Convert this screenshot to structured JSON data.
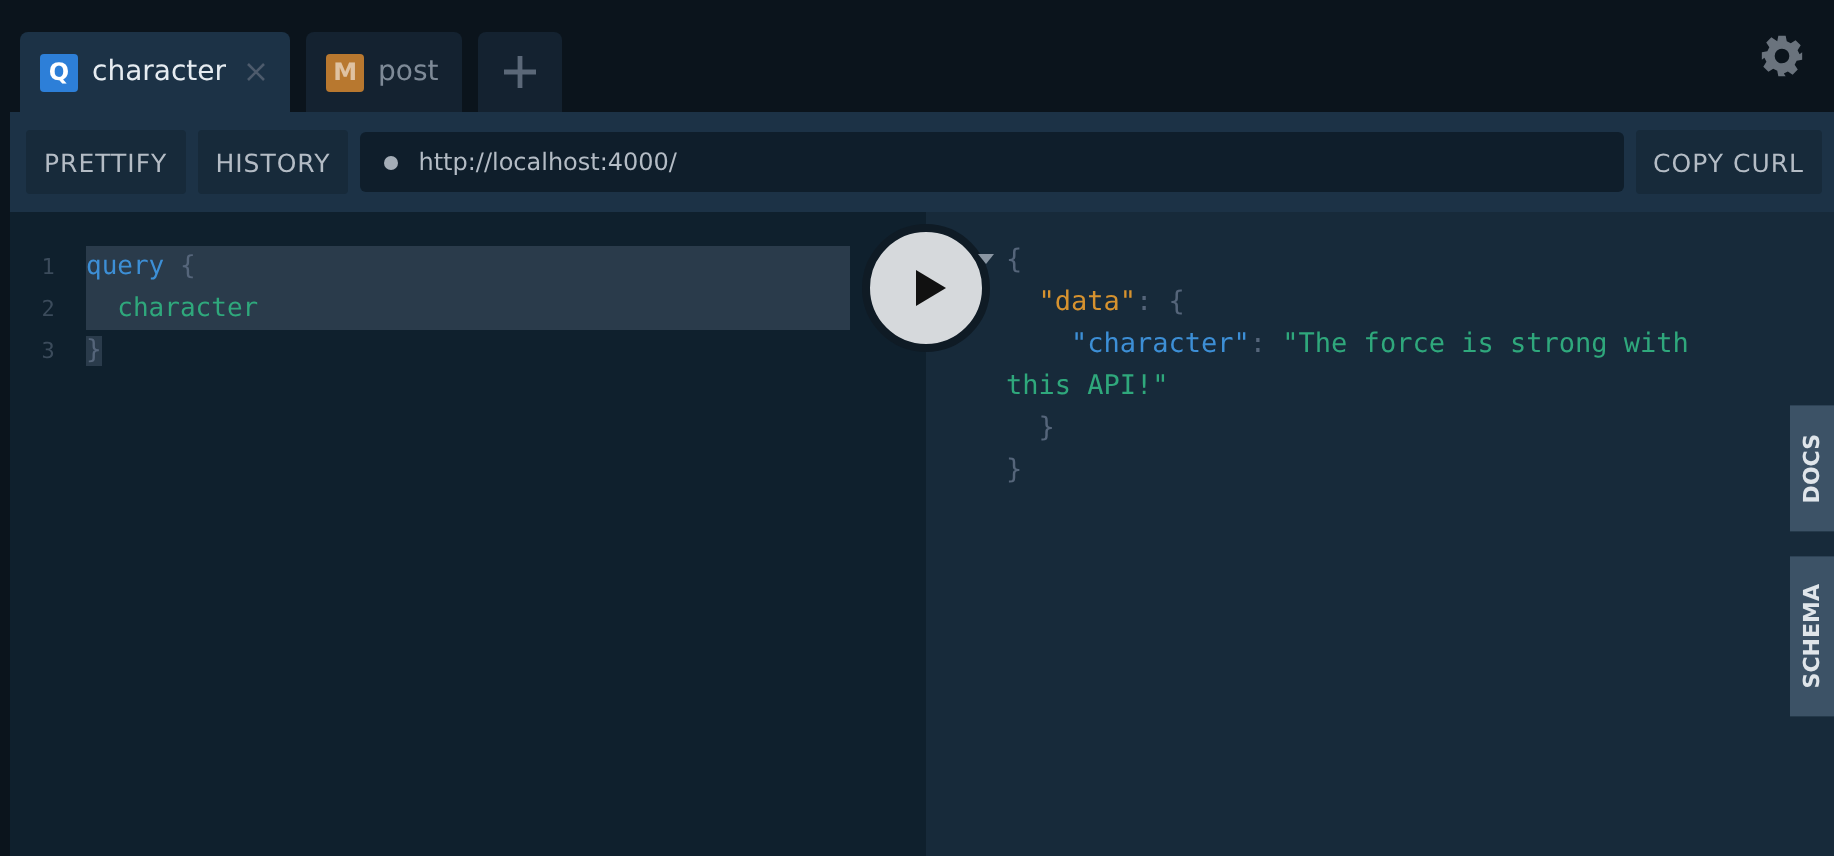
{
  "tabs": [
    {
      "badge": "Q",
      "color": "#2d7fd8",
      "label": "character",
      "selected": true,
      "closable": true
    },
    {
      "badge": "M",
      "color": "#b8782f",
      "label": "post",
      "selected": false,
      "closable": false
    }
  ],
  "toolbar": {
    "buttons": [
      "PRETTIFY",
      "HISTORY"
    ],
    "endpoint": "http://localhost:4000/",
    "copy_button": "COPY CURL"
  },
  "editor": {
    "lines": [
      {
        "number": "1",
        "selected": true,
        "tokens": [
          {
            "kind": "keyword",
            "text": "query"
          },
          {
            "kind": "punct",
            "text": " {"
          }
        ]
      },
      {
        "number": "2",
        "selected": true,
        "tokens": [
          {
            "kind": "field",
            "text": "  character"
          }
        ]
      },
      {
        "number": "3",
        "selected": false,
        "tokens": [
          {
            "kind": "punct",
            "text": "}",
            "selected": true
          }
        ]
      }
    ]
  },
  "result": {
    "tree": {
      "collapsible": true,
      "tokens": [
        {
          "kind": "punct",
          "text": "{"
        }
      ],
      "close": "}",
      "children": [
        {
          "collapsible": false,
          "tokens": [
            {
              "kind": "key",
              "text": "\"data\""
            },
            {
              "kind": "punct",
              "text": ": {"
            }
          ],
          "close": "}",
          "children": [
            {
              "collapsible": false,
              "tokens": [
                {
                  "kind": "prop",
                  "text": "\"character\""
                },
                {
                  "kind": "punct",
                  "text": ": "
                },
                {
                  "kind": "string",
                  "text": "\"The force is strong with this API!\""
                }
              ]
            }
          ]
        }
      ]
    }
  },
  "side_tabs": [
    "DOCS",
    "SCHEMA"
  ]
}
